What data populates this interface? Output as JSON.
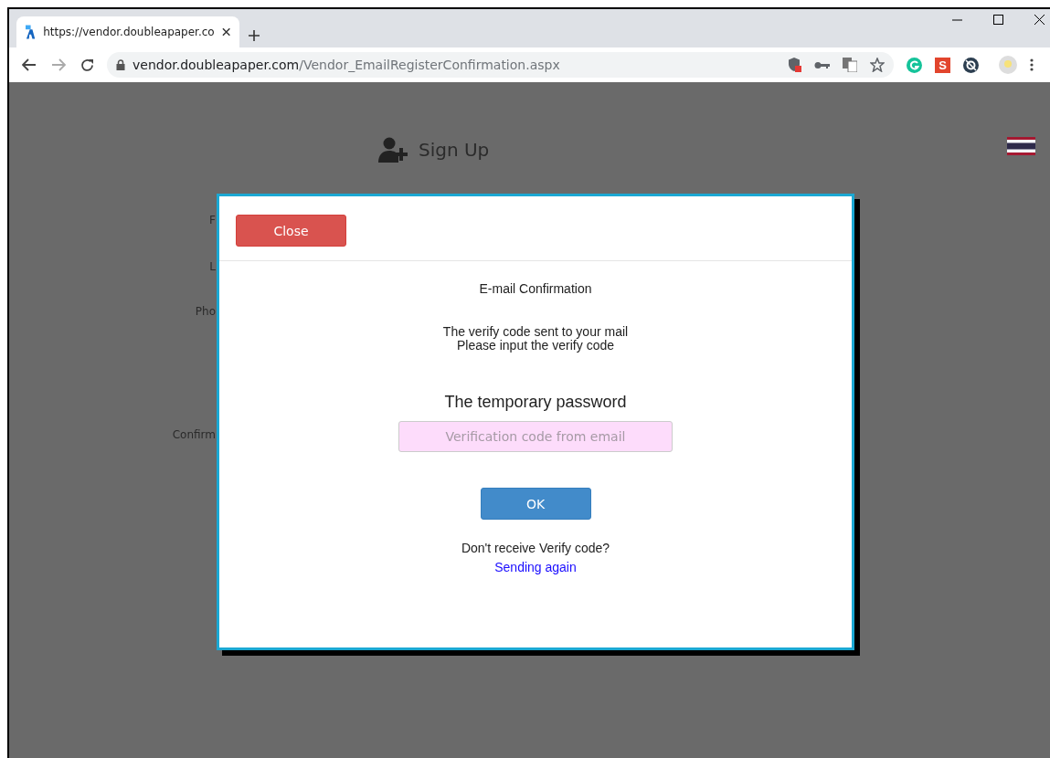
{
  "browser": {
    "tab_title": "https://vendor.doubleapaper.co",
    "address": {
      "host": "vendor.doubleapaper.com",
      "path": "/Vendor_EmailRegisterConfirmation.aspx"
    },
    "extension_letter": "S"
  },
  "page": {
    "heading": "Sign Up",
    "form_labels": [
      "F",
      "L",
      "Pho",
      "Confirm"
    ]
  },
  "dialog": {
    "close_button": "Close",
    "title": "E-mail Confirmation",
    "message_lines": [
      "The verify code sent to your mail",
      "Please input the verify code"
    ],
    "field_label": "The temporary password",
    "field": {
      "placeholder": "Verification code from email"
    },
    "ok_button": "OK",
    "prompt": "Don't receive Verify code?",
    "resend_link": "Sending again"
  }
}
